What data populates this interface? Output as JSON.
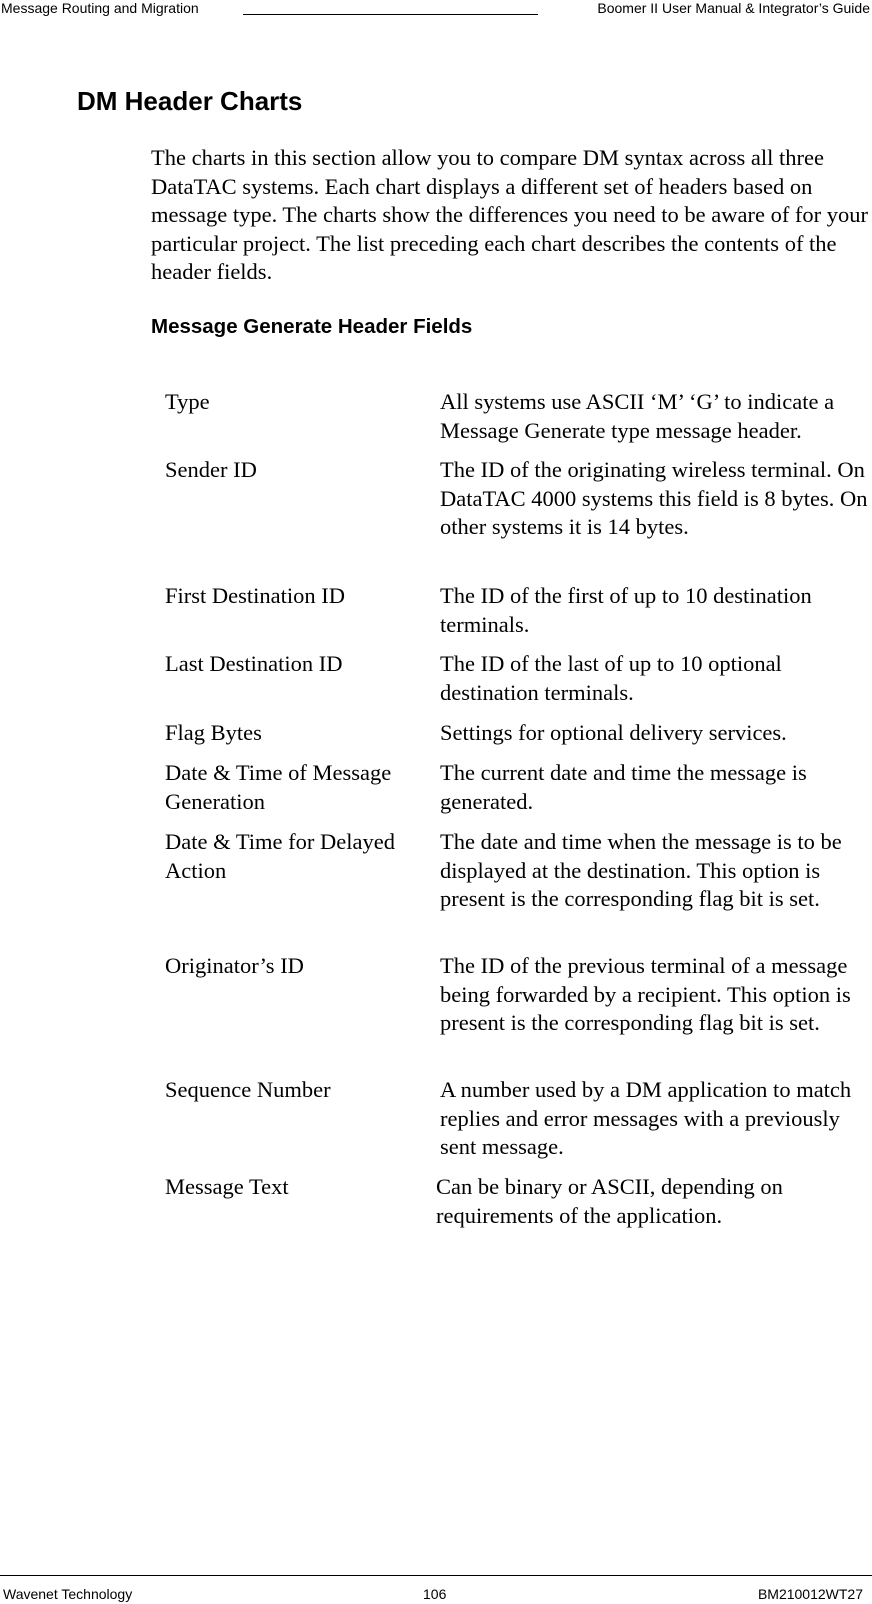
{
  "page_header": {
    "left": "Message Routing and Migration",
    "right": "Boomer II User Manual & Integrator’s Guide"
  },
  "section": {
    "title": "DM Header Charts",
    "intro": "The charts in this section allow you to compare DM syntax across all three DataTAC systems. Each chart displays a different set of headers based on message type. The charts show the differences you need to be aware of for your particular project. The list preceding each chart describes the contents of the header fields.",
    "subtitle": "Message Generate Header Fields"
  },
  "fields": [
    {
      "term": "Type",
      "desc": "All systems use ASCII ‘M’ ‘G’ to indicate a Message Generate type message header."
    },
    {
      "term": "Sender ID",
      "desc": "The ID of the originating wireless terminal. On DataTAC 4000 systems this field is 8 bytes. On other systems it is 14 bytes."
    },
    {
      "term": "First Destination ID",
      "desc": "The ID of the first of up to 10 destination terminals."
    },
    {
      "term": "Last Destination ID",
      "desc": "The ID of the last of up to 10 optional destination terminals."
    },
    {
      "term": "Flag Bytes",
      "desc": "Settings for optional delivery services."
    },
    {
      "term": "Date & Time of Message Generation",
      "desc": "The current date and time the message is generated."
    },
    {
      "term": "Date & Time for Delayed Action",
      "desc": "The date and time when the message is to be displayed at the destination. This option is present is the corresponding flag bit is set."
    },
    {
      "term": "Originator’s ID",
      "desc": "The ID of the previous terminal of a message being forwarded by a recipient. This option is present is the corresponding flag bit is set."
    },
    {
      "term": "Sequence Number",
      "desc": "A number used by a DM application to match replies and error messages with a previously sent message."
    },
    {
      "term": "Message Text",
      "desc": "Can be binary or ASCII, depending on requirements of the application."
    }
  ],
  "page_footer": {
    "left": "Wavenet Technology",
    "page_number": "106",
    "right": "BM210012WT27"
  }
}
